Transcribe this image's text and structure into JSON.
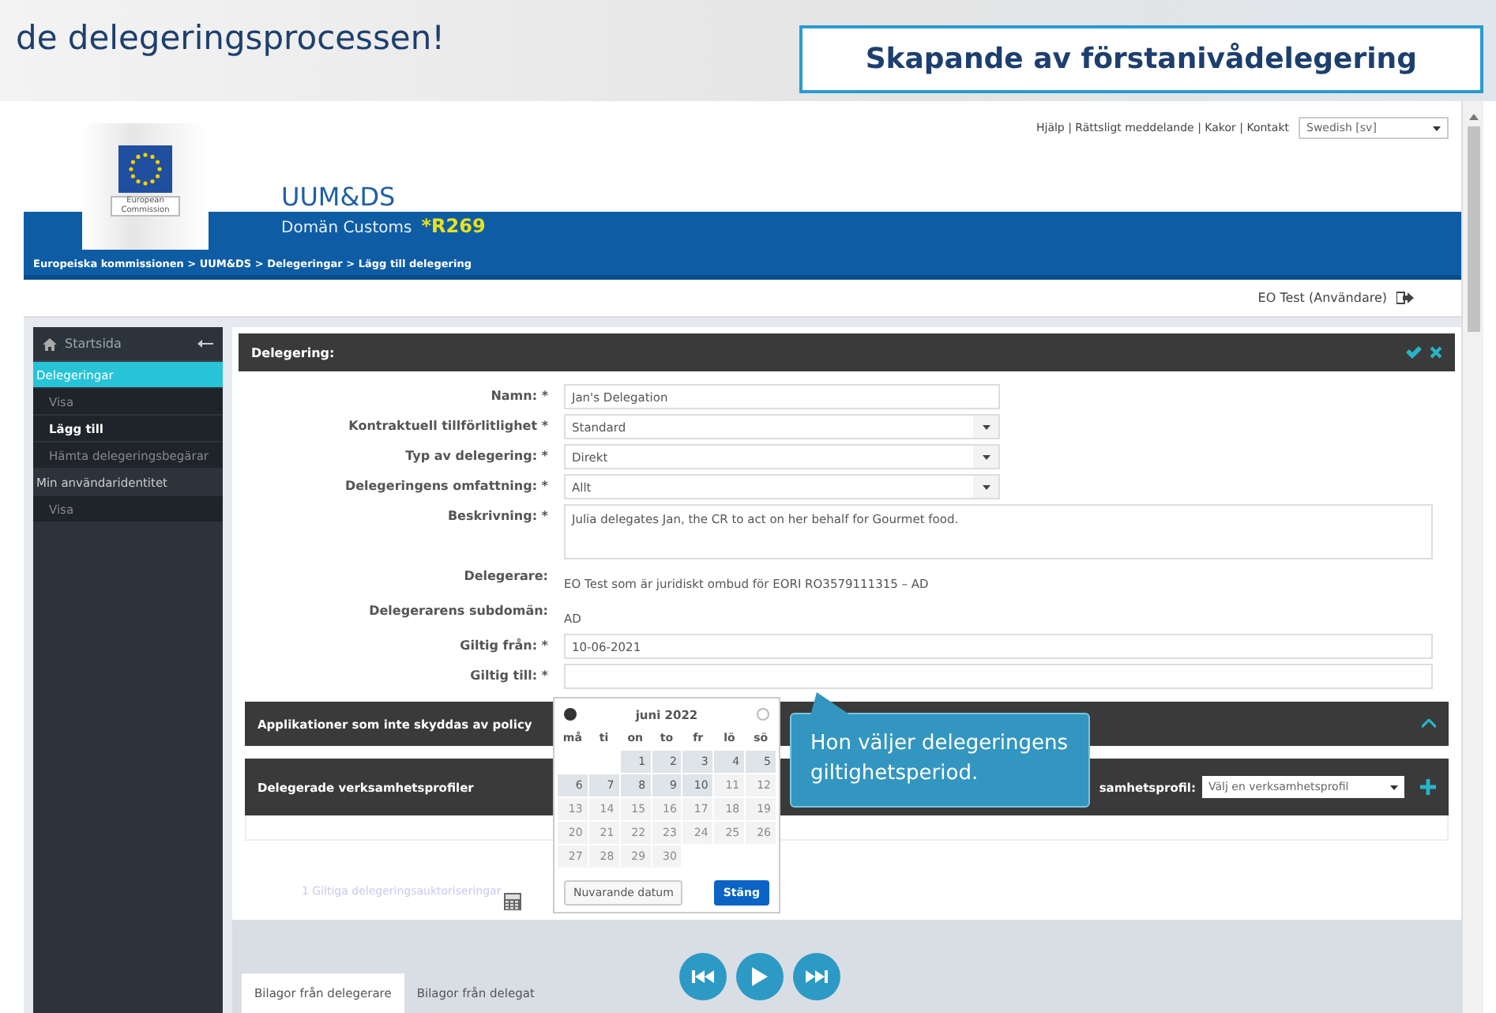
{
  "banner": {
    "left_text": "de delegeringsprocessen!",
    "title": "Skapande av förstanivådelegering"
  },
  "header": {
    "links": "Hjälp | Rättsligt meddelande | Kakor | Kontakt",
    "language": "Swedish [sv]",
    "logo_text": "European Commission",
    "app_title": "UUM&DS",
    "domain": "Domän Customs",
    "domain_code": "*R269",
    "breadcrumb": "Europeiska kommissionen > UUM&DS > Delegeringar > Lägg till delegering",
    "user": "EO Test (Användare)"
  },
  "sidebar": {
    "home": "Startsida",
    "items": [
      {
        "label": "Delegeringar",
        "kind": "section",
        "selected": true
      },
      {
        "label": "Visa",
        "kind": "item",
        "selected": false
      },
      {
        "label": "Lägg till",
        "kind": "item",
        "selected": true
      },
      {
        "label": "Hämta delegeringsbegärar",
        "kind": "item",
        "selected": false
      },
      {
        "label": "Min användaridentitet",
        "kind": "section",
        "selected": false
      },
      {
        "label": "Visa",
        "kind": "item",
        "selected": false
      }
    ]
  },
  "panel": {
    "title": "Delegering:",
    "fields": [
      {
        "label": "Namn: *",
        "kind": "text",
        "value": "Jan's Delegation"
      },
      {
        "label": "Kontraktuell tillförlitlighet *",
        "kind": "select",
        "value": "Standard"
      },
      {
        "label": "Typ av delegering: *",
        "kind": "select",
        "value": "Direkt"
      },
      {
        "label": "Delegeringens omfattning: *",
        "kind": "select",
        "value": "Allt"
      },
      {
        "label": "Beskrivning: *",
        "kind": "textarea",
        "value": "Julia delegates Jan, the CR to act on her behalf for Gourmet food."
      },
      {
        "label": "Delegerare:",
        "kind": "static",
        "value": "EO Test som är juridiskt ombud för EORI RO3579111315 – AD"
      },
      {
        "label": "Delegerarens subdomän:",
        "kind": "static",
        "value": "AD"
      },
      {
        "label": "Giltig från: *",
        "kind": "wide",
        "value": "10-06-2021"
      },
      {
        "label": "Giltig till: *",
        "kind": "wide"
      }
    ],
    "sections": [
      {
        "title": "Applikationer som inte skyddas av policy",
        "kind": "collapse"
      },
      {
        "title": "Delegerade verksamhetsprofiler",
        "kind": "profile",
        "profile_label": "samhetsprofil:",
        "profile_value": "Välj en verksamhetsprofil"
      }
    ],
    "authorizations_link": "1 Giltiga delegeringsauktoriseringar",
    "tabs": [
      {
        "label": "Bilagor från delegerare",
        "selected": true
      },
      {
        "label": "Bilagor från delegat",
        "selected": false
      }
    ]
  },
  "calendar": {
    "month": "juni 2022",
    "weekdays": [
      "må",
      "ti",
      "on",
      "to",
      "fr",
      "lö",
      "sö"
    ],
    "weeks": [
      [
        {
          "kind": "empty"
        },
        {
          "kind": "empty"
        },
        {
          "kind": "day",
          "day": "1",
          "disabled": false
        },
        {
          "kind": "day",
          "day": "2",
          "disabled": false
        },
        {
          "kind": "day",
          "day": "3",
          "disabled": false
        },
        {
          "kind": "day",
          "day": "4",
          "disabled": false
        },
        {
          "kind": "day",
          "day": "5",
          "disabled": false
        }
      ],
      [
        {
          "kind": "day",
          "day": "6",
          "disabled": false
        },
        {
          "kind": "day",
          "day": "7",
          "disabled": false
        },
        {
          "kind": "day",
          "day": "8",
          "disabled": false
        },
        {
          "kind": "day",
          "day": "9",
          "disabled": false
        },
        {
          "kind": "day",
          "day": "10",
          "disabled": false
        },
        {
          "kind": "day",
          "day": "11",
          "disabled": true
        },
        {
          "kind": "day",
          "day": "12",
          "disabled": true
        }
      ],
      [
        {
          "kind": "day",
          "day": "13",
          "disabled": true
        },
        {
          "kind": "day",
          "day": "14",
          "disabled": true
        },
        {
          "kind": "day",
          "day": "15",
          "disabled": true
        },
        {
          "kind": "day",
          "day": "16",
          "disabled": true
        },
        {
          "kind": "day",
          "day": "17",
          "disabled": true
        },
        {
          "kind": "day",
          "day": "18",
          "disabled": true
        },
        {
          "kind": "day",
          "day": "19",
          "disabled": true
        }
      ],
      [
        {
          "kind": "day",
          "day": "20",
          "disabled": true
        },
        {
          "kind": "day",
          "day": "21",
          "disabled": true
        },
        {
          "kind": "day",
          "day": "22",
          "disabled": true
        },
        {
          "kind": "day",
          "day": "23",
          "disabled": true
        },
        {
          "kind": "day",
          "day": "24",
          "disabled": true
        },
        {
          "kind": "day",
          "day": "25",
          "disabled": true
        },
        {
          "kind": "day",
          "day": "26",
          "disabled": true
        }
      ],
      [
        {
          "kind": "day",
          "day": "27",
          "disabled": true
        },
        {
          "kind": "day",
          "day": "28",
          "disabled": true
        },
        {
          "kind": "day",
          "day": "29",
          "disabled": true
        },
        {
          "kind": "day",
          "day": "30",
          "disabled": true
        },
        {
          "kind": "empty"
        },
        {
          "kind": "empty"
        },
        {
          "kind": "empty"
        }
      ]
    ],
    "today_button": "Nuvarande datum",
    "close_button": "Stäng"
  },
  "callout": {
    "text": "Hon väljer delegeringens giltighetsperiod."
  }
}
